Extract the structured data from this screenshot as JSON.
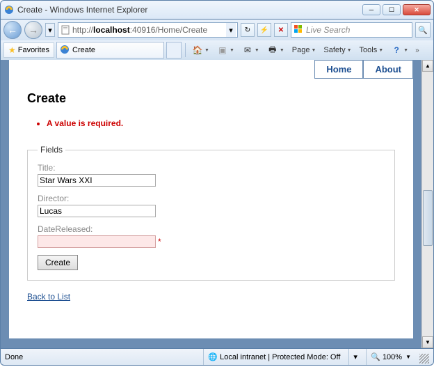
{
  "window": {
    "title": "Create - Windows Internet Explorer"
  },
  "nav": {
    "url_prefix": "http://",
    "url_bold": "localhost",
    "url_suffix": ":40916/Home/Create",
    "search_placeholder": "Live Search"
  },
  "favbar": {
    "favorites": "Favorites",
    "tab_title": "Create",
    "menu": {
      "page": "Page",
      "safety": "Safety",
      "tools": "Tools"
    }
  },
  "page": {
    "navtabs": {
      "home": "Home",
      "about": "About"
    },
    "heading": "Create",
    "error": "A value is required.",
    "legend": "Fields",
    "fields": {
      "title_label": "Title:",
      "title_value": "Star Wars XXI",
      "director_label": "Director:",
      "director_value": "Lucas",
      "date_label": "DateReleased:",
      "date_value": ""
    },
    "submit": "Create",
    "back": "Back to List"
  },
  "status": {
    "done": "Done",
    "zone": "Local intranet | Protected Mode: Off",
    "zoom": "100%"
  }
}
